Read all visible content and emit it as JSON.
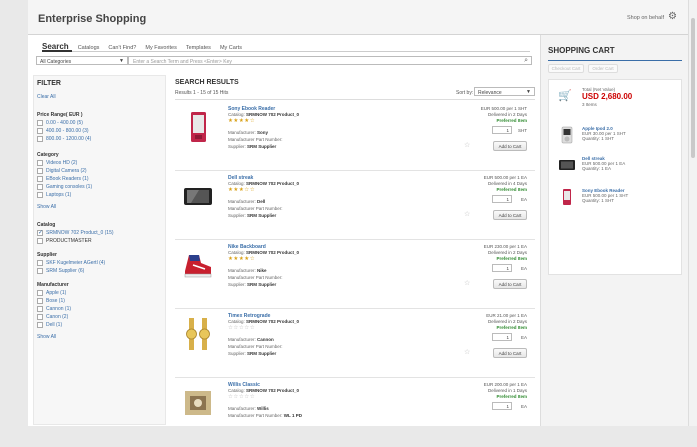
{
  "app": {
    "title": "Enterprise Shopping",
    "shop_behalf": "Shop on behalf"
  },
  "tabs": [
    "Search",
    "Catalogs",
    "Can't Find?",
    "My Favorites",
    "Templates",
    "My Carts"
  ],
  "search": {
    "category": "All Categories",
    "placeholder": "Enter a Search Term and Press <Enter> Key"
  },
  "filter": {
    "title": "FILTER",
    "clear_all": "Clear All",
    "price_title": "Price Range( EUR )",
    "price_items": [
      "0.00 - 400.00 (5)",
      "400.00 - 800.00 (3)",
      "800.00 - 1200.00 (4)"
    ],
    "category_title": "Category",
    "category_items": [
      "Videos HD (2)",
      "Digital Camera (2)",
      "EBook Readers (1)",
      "Gaming consoles (1)",
      "Laptops (1)"
    ],
    "show_all": "Show All",
    "catalog_title": "Catalog",
    "catalog_items": [
      "SRMNOW 702 Product_0 (15)",
      "PRODUCTMASTER"
    ],
    "supplier_title": "Supplier",
    "supplier_items": [
      "SKF Kugelmeier AGertl (4)",
      "SRM Supplier (6)"
    ],
    "manufacturer_title": "Manufacturer",
    "manufacturer_items": [
      "Apple (1)",
      "Bose (1)",
      "Cannon (1)",
      "Canon (2)",
      "Dell (1)"
    ],
    "show_all_2": "Show All"
  },
  "results": {
    "title": "SEARCH RESULTS",
    "meta": "Results 1 - 15 of 15 Hits",
    "sort_label": "Sort by:",
    "sort_value": "Relevance",
    "catalog_label": "Catalog:",
    "mfr_label": "Manufacturer:",
    "mpn_label": "Manufacturer Part Number:",
    "supplier_label": "Supplier:",
    "add_label": "Add to Cart",
    "items": [
      {
        "name": "Sony Ebook Reader",
        "catalog": "SRMNOW 702 Product_0",
        "manufacturer": "Sony",
        "mpn": "",
        "supplier": "SRM Supplier",
        "price": "EUR 500.00 per 1 SHT",
        "delivery": "Delivered in 2 Days",
        "preferred": "Preferred Item",
        "qty": "1",
        "unit": "SHT",
        "rating": "★★★★☆"
      },
      {
        "name": "Dell streak",
        "catalog": "SRMNOW 702 Product_0",
        "manufacturer": "Dell",
        "mpn": "",
        "supplier": "SRM Supplier",
        "price": "EUR 500.00 per 1 EA",
        "delivery": "Delivered in 4 Days",
        "preferred": "Preferred Item",
        "qty": "1",
        "unit": "EA",
        "rating": "★★★☆☆"
      },
      {
        "name": "Nike Backboard",
        "catalog": "SRMNOW 702 Product_0",
        "manufacturer": "Nike",
        "mpn": "",
        "supplier": "SRM Supplier",
        "price": "EUR 230.00 per 1 EA",
        "delivery": "Delivered in 2 Days",
        "preferred": "Preferred Item",
        "qty": "1",
        "unit": "EA",
        "rating": "★★★★☆"
      },
      {
        "name": "Timex Retrograde",
        "catalog": "SRMNOW 702 Product_0",
        "manufacturer": "Cannon",
        "mpn": "",
        "supplier": "SRM Supplier",
        "price": "EUR 21.00 per 1 EA",
        "delivery": "Delivered in 2 Days",
        "preferred": "Preferred Item",
        "qty": "1",
        "unit": "EA",
        "rating": "☆☆☆☆☆"
      },
      {
        "name": "Willis Classic",
        "catalog": "SRMNOW 702 Product_0",
        "manufacturer": "Willis",
        "mpn": "WL 1 PD",
        "supplier": "SRM Supplier",
        "price": "EUR 200.00 per 1 EA",
        "delivery": "Delivered in 1 Days",
        "preferred": "Preferred Item",
        "qty": "1",
        "unit": "EA",
        "rating": "☆☆☆☆☆"
      }
    ]
  },
  "cart": {
    "title": "SHOPPING CART",
    "btn_checkout": "Checkout Cart",
    "btn_order": "Order Cart",
    "total_label": "Total (Net Value)",
    "total_value": "USD 2,680.00",
    "total_items": "3 Items",
    "items": [
      {
        "name": "Apple Ipod 2.0",
        "price": "EUR 30.00 per 1 SHT",
        "qty": "Quantity: 1 SHT"
      },
      {
        "name": "Dell streak",
        "price": "EUR 500.00 per 1 EA",
        "qty": "Quantity: 1 EA"
      },
      {
        "name": "Sony Ebook Reader",
        "price": "EUR 500.00 per 1 SHT",
        "qty": "Quantity: 1 SHT"
      }
    ]
  },
  "colors": {
    "link": "#3a6ea8",
    "price_total": "#cc0000",
    "preferred": "#2e8a2e",
    "stars": "#d9a21b"
  }
}
